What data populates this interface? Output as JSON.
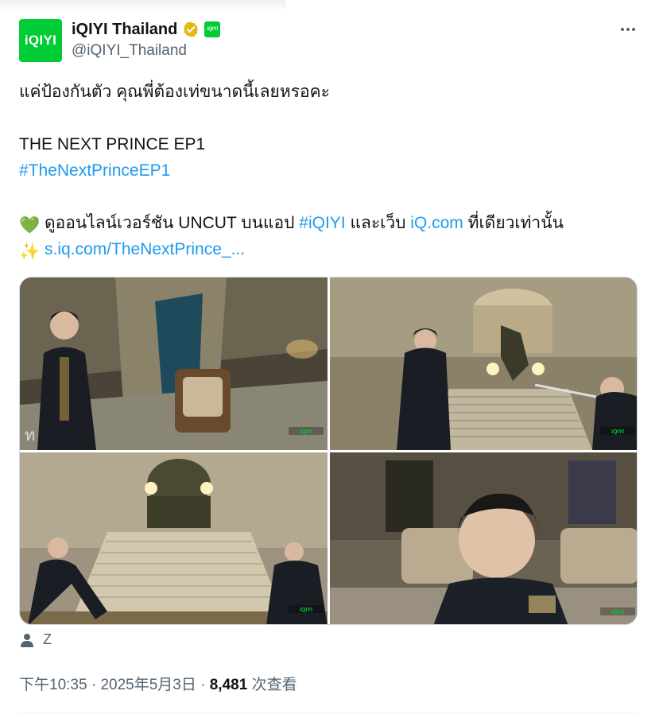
{
  "author": {
    "display_name": "iQIYI Thailand",
    "handle": "@iQIYI_Thailand",
    "avatar_text": "iQIYI",
    "badge_text": "iQIYI",
    "verified_color": "#e2b719",
    "brand_color": "#00cc36"
  },
  "tweet": {
    "line1": "แค่ป้องกันตัว คุณพี่ต้องเท่ขนาดนี้เลยหรอคะ",
    "line2": "THE NEXT PRINCE EP1",
    "hashtag1": "#TheNextPrinceEP1",
    "line3_part1": "ดูออนไลน์เวอร์ชัน UNCUT บนแอป",
    "hashtag2": "#iQIYI",
    "line3_part2": "และเว็บ",
    "site_link": "iQ.com",
    "line3_part3": "ที่เดียวเท่านั้น",
    "short_link": "s.iq.com/TheNextPrince_...",
    "emoji_heart": "💚",
    "emoji_sparkles": "✨"
  },
  "media": {
    "images": [
      {
        "name": "Scene 1",
        "watermark": "iQIYI"
      },
      {
        "name": "Scene 2",
        "watermark": "iQIYI"
      },
      {
        "name": "Scene 3",
        "watermark": "iQIYI"
      },
      {
        "name": "Scene 4",
        "watermark": "iQIYI"
      }
    ]
  },
  "tagged": {
    "name": "Z",
    "icon": "person-icon"
  },
  "meta": {
    "time": "下午10:35",
    "separator": "·",
    "date": "2025年5月3日",
    "views": "8,481",
    "views_label": "次查看"
  },
  "colors": {
    "link": "#1d9bf0",
    "secondary_text": "#536471",
    "primary_text": "#0f1419"
  }
}
